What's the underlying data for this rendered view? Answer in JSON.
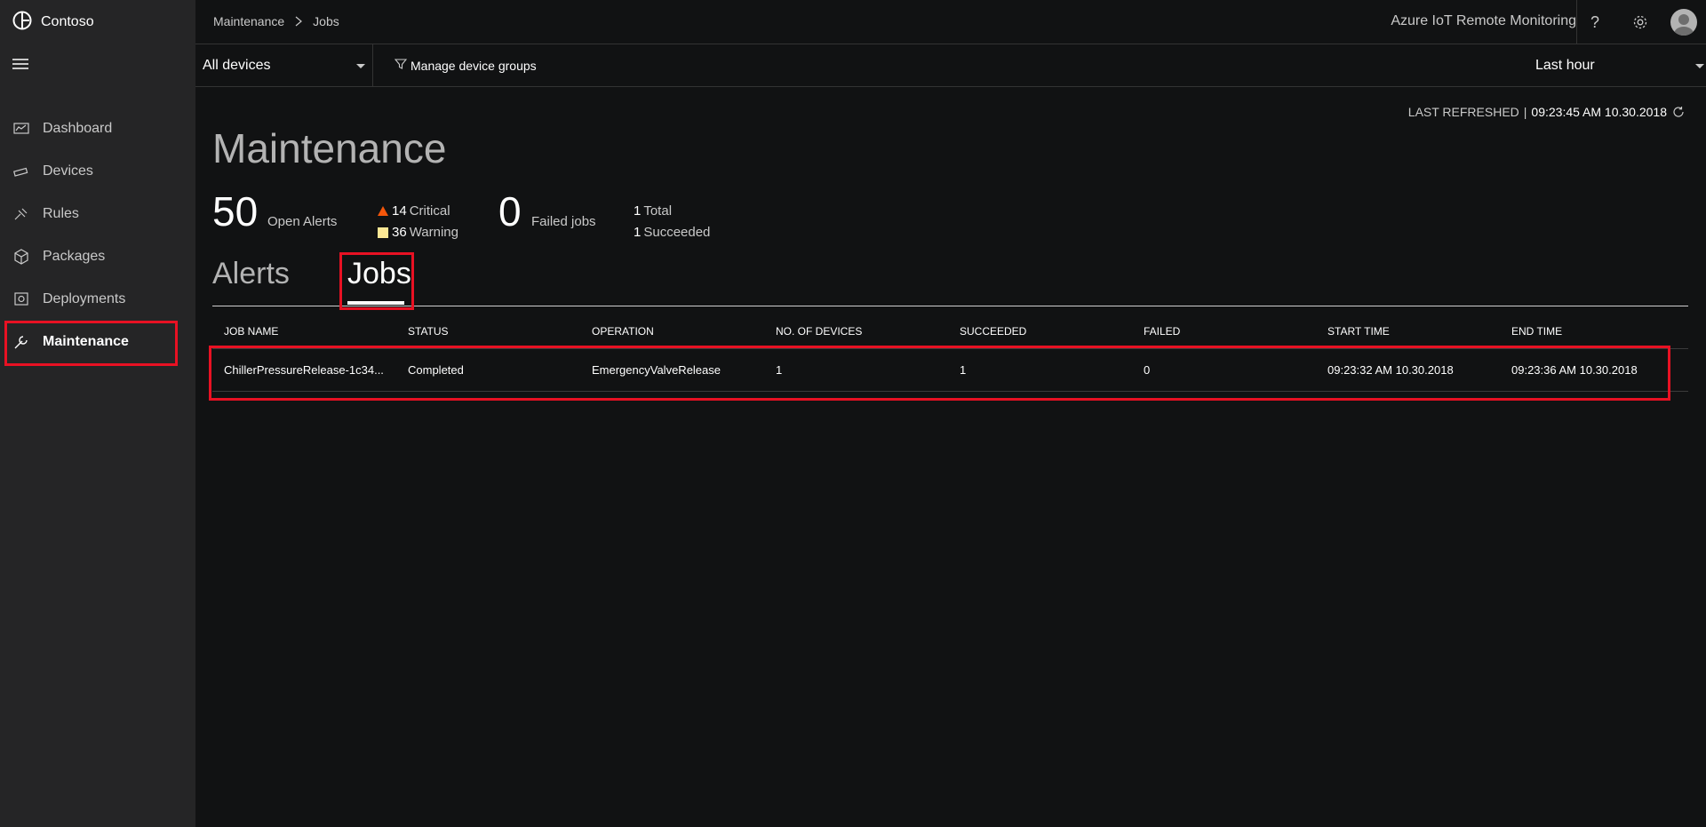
{
  "brand": {
    "name": "Contoso"
  },
  "sidebar": {
    "items": [
      {
        "label": "Dashboard",
        "icon": "dashboard-icon"
      },
      {
        "label": "Devices",
        "icon": "devices-icon"
      },
      {
        "label": "Rules",
        "icon": "rules-icon"
      },
      {
        "label": "Packages",
        "icon": "packages-icon"
      },
      {
        "label": "Deployments",
        "icon": "deployments-icon"
      },
      {
        "label": "Maintenance",
        "icon": "maintenance-icon",
        "active": true
      }
    ]
  },
  "header": {
    "breadcrumb": [
      "Maintenance",
      "Jobs"
    ],
    "app_title": "Azure IoT Remote Monitoring",
    "help_label": "?"
  },
  "context": {
    "device_group": "All devices",
    "manage_label": "Manage device groups",
    "time_range": "Last hour"
  },
  "refresh": {
    "label": "LAST REFRESHED",
    "separator": "|",
    "timestamp": "09:23:45 AM 10.30.2018"
  },
  "page": {
    "title": "Maintenance"
  },
  "stats": {
    "open_alerts_count": "50",
    "open_alerts_label": "Open Alerts",
    "critical_count": "14",
    "critical_label": "Critical",
    "warning_count": "36",
    "warning_label": "Warning",
    "failed_jobs_count": "0",
    "failed_jobs_label": "Failed jobs",
    "total_count": "1",
    "total_label": "Total",
    "succeeded_count": "1",
    "succeeded_label": "Succeeded"
  },
  "tabs": [
    {
      "label": "Alerts",
      "active": false
    },
    {
      "label": "Jobs",
      "active": true
    }
  ],
  "table": {
    "columns": [
      "JOB NAME",
      "STATUS",
      "OPERATION",
      "NO. OF DEVICES",
      "SUCCEEDED",
      "FAILED",
      "START TIME",
      "END TIME"
    ],
    "rows": [
      [
        "ChillerPressureRelease-1c34...",
        "Completed",
        "EmergencyValveRelease",
        "1",
        "1",
        "0",
        "09:23:32 AM 10.30.2018",
        "09:23:36 AM 10.30.2018"
      ]
    ]
  },
  "colors": {
    "background": "#111213",
    "sidebar": "#252526",
    "highlight": "#e81123",
    "critical": "#f5560a",
    "warning": "#fce795"
  }
}
